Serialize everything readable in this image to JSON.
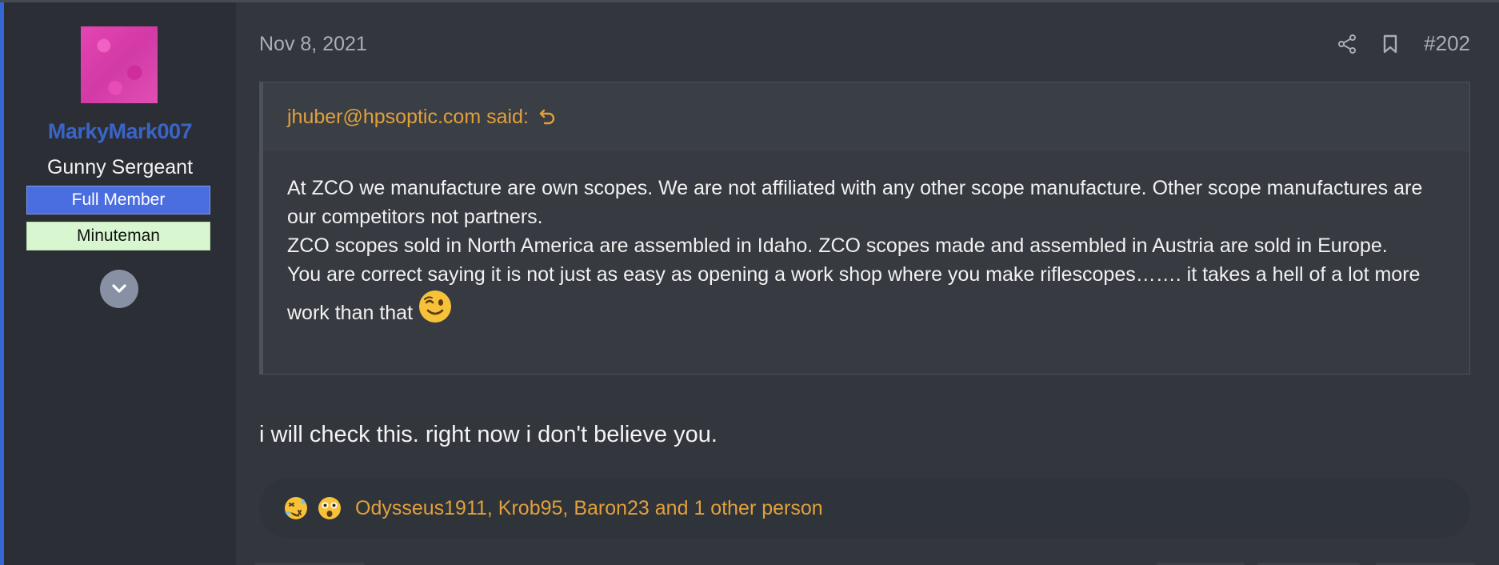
{
  "post": {
    "date": "Nov 8, 2021",
    "number": "#202",
    "message": "i will check this. right now i don't believe you."
  },
  "user": {
    "name": "MarkyMark007",
    "title": "Gunny Sergeant",
    "banners": [
      "Full Member",
      "Minuteman"
    ]
  },
  "quote": {
    "author_said": "jhuber@hpsoptic.com said:",
    "lines": [
      "At ZCO we manufacture are own scopes. We are not affiliated with any other scope manufacture. Other scope manufactures are our competitors not partners.",
      "ZCO scopes sold in North America are assembled in Idaho. ZCO scopes made and assembled in Austria are sold in Europe.",
      "You are correct saying it is not just as easy as opening a work shop where you make riflescopes……. it takes a hell of a lot more work than that"
    ]
  },
  "reactions": {
    "icons": [
      "rolling-on-floor-laughing",
      "astonished-face"
    ],
    "users_text": "Odysseus1911, Krob95, Baron23 and 1 other person"
  },
  "colors": {
    "accent": "#3466d4",
    "username": "#3a64c8",
    "link": "#e2a03b",
    "full_member_banner": "#4a6de0",
    "minuteman_banner": "#d8f7d0",
    "background": "#33363d"
  }
}
